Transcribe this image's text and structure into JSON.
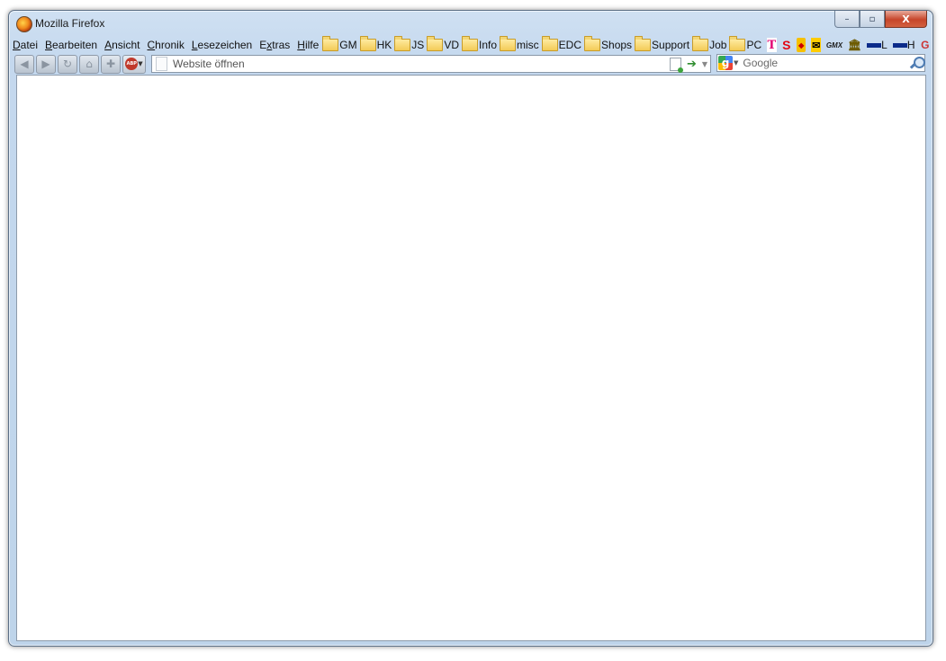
{
  "window": {
    "title": "Mozilla Firefox"
  },
  "caption": {
    "minimize": "–",
    "maximize": "▫",
    "close": "X"
  },
  "menu": [
    "Datei",
    "Bearbeiten",
    "Ansicht",
    "Chronik",
    "Lesezeichen",
    "Extras",
    "Hilfe"
  ],
  "menu_access_keys": [
    "D",
    "B",
    "A",
    "C",
    "L",
    "x",
    "H"
  ],
  "bookmarks": [
    "GM",
    "HK",
    "JS",
    "VD",
    "Info",
    "misc",
    "EDC",
    "Shops",
    "Support",
    "Job",
    "PC"
  ],
  "bookmark_icons": {
    "telekom": "T",
    "sparkasse": "S",
    "gmx": "GMX",
    "flag_l": "L",
    "flag_h": "H"
  },
  "nav": {
    "back": "back-icon",
    "forward": "forward-icon",
    "reload": "reload-icon",
    "home": "home-icon",
    "abp_badge": "ABP"
  },
  "urlbar": {
    "placeholder": "Website öffnen",
    "value": ""
  },
  "search": {
    "engine": "Google",
    "placeholder": "Google",
    "value": ""
  }
}
